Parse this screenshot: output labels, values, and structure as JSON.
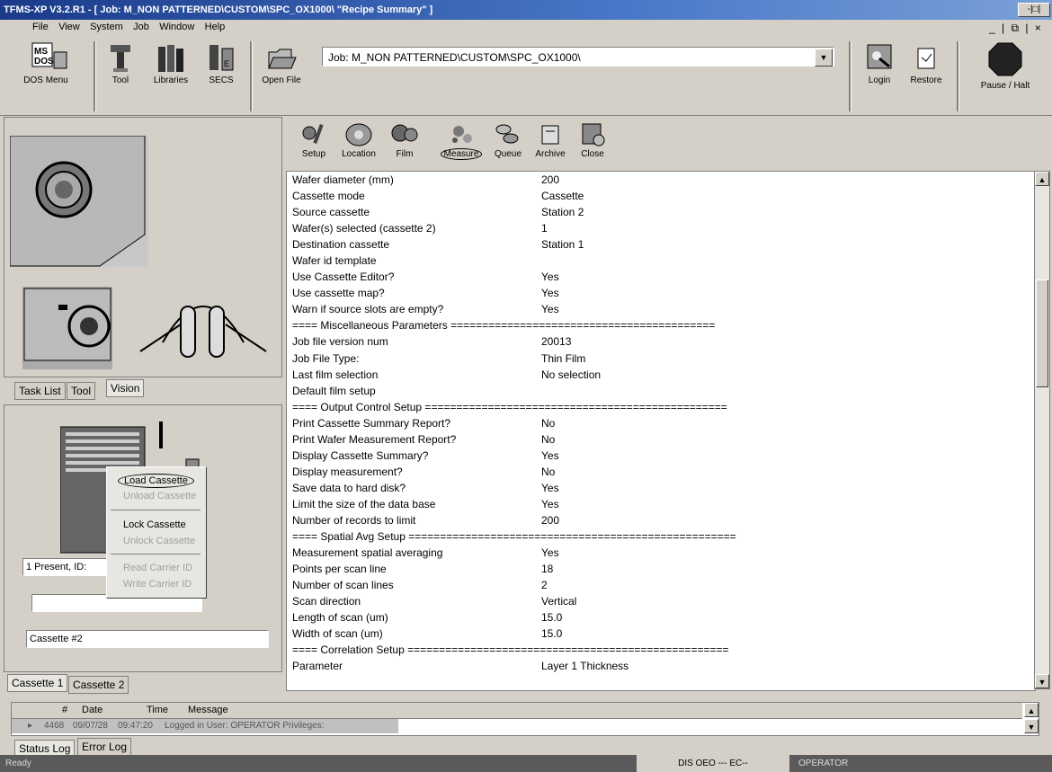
{
  "window": {
    "title": "TFMS-XP V3.2.R1 - [ Job: M_NON PATTERNED\\CUSTOM\\SPC_OX1000\\   \"Recipe Summary\" ]",
    "restore_glyph": "-|□|",
    "doc_controls": "_ | ⧉ | ×"
  },
  "menu": [
    "File",
    "View",
    "System",
    "Job",
    "Window",
    "Help"
  ],
  "toolbar": {
    "dos_menu": "DOS Menu",
    "tool": "Tool",
    "libraries": "Libraries",
    "secs": "SECS",
    "open_file": "Open File",
    "job_field": "Job: M_NON PATTERNED\\CUSTOM\\SPC_OX1000\\",
    "login": "Login",
    "restore": "Restore",
    "pause_halt": "Pause / Halt"
  },
  "recipe_tools": [
    "Setup",
    "Location",
    "Film",
    "Measure",
    "Queue",
    "Archive",
    "Close"
  ],
  "summary_rows": [
    {
      "k": "Wafer diameter (mm)",
      "v": "200"
    },
    {
      "k": "Cassette mode",
      "v": "Cassette"
    },
    {
      "k": "Source cassette",
      "v": "Station 2"
    },
    {
      "k": "Wafer(s) selected (cassette 2)",
      "v": "1"
    },
    {
      "k": "Destination cassette",
      "v": "Station 1"
    },
    {
      "k": "Wafer id template",
      "v": ""
    },
    {
      "k": "Use Cassette Editor?",
      "v": "Yes"
    },
    {
      "k": "Use cassette map?",
      "v": "Yes"
    },
    {
      "k": "Warn if source slots are empty?",
      "v": "Yes"
    },
    {
      "k": "==== Miscellaneous Parameters ==========================================",
      "v": ""
    },
    {
      "k": "Job file version num",
      "v": "20013"
    },
    {
      "k": "Job File Type:",
      "v": "Thin Film"
    },
    {
      "k": "Last film selection",
      "v": "No selection"
    },
    {
      "k": "Default film setup",
      "v": ""
    },
    {
      "k": "==== Output Control Setup ================================================",
      "v": ""
    },
    {
      "k": "Print Cassette Summary Report?",
      "v": "No"
    },
    {
      "k": "Print Wafer Measurement Report?",
      "v": "No"
    },
    {
      "k": "Display Cassette Summary?",
      "v": "Yes"
    },
    {
      "k": "Display measurement?",
      "v": "No"
    },
    {
      "k": "Save data to hard disk?",
      "v": "Yes"
    },
    {
      "k": "Limit the size of the data base",
      "v": "Yes"
    },
    {
      "k": "Number of records to limit",
      "v": "200"
    },
    {
      "k": "==== Spatial Avg Setup ====================================================",
      "v": ""
    },
    {
      "k": "Measurement spatial averaging",
      "v": "Yes"
    },
    {
      "k": "Points per scan line",
      "v": "18"
    },
    {
      "k": "Number of scan lines",
      "v": "2"
    },
    {
      "k": "Scan direction",
      "v": "Vertical"
    },
    {
      "k": "Length of scan (um)",
      "v": "15.0"
    },
    {
      "k": "Width of scan (um)",
      "v": "15.0"
    },
    {
      "k": "==== Correlation Setup ===================================================",
      "v": ""
    },
    {
      "k": "Parameter",
      "v": "Layer 1 Thickness"
    }
  ],
  "left_tabs": [
    "Task List",
    "Tool",
    "Vision"
  ],
  "cassette_panel": {
    "present_field": "1 Present, ID:",
    "cassette_label": "Cassette #2",
    "tabs": [
      "Cassette 1",
      "Cassette 2"
    ]
  },
  "context_menu": {
    "load": "Load Cassette",
    "unload": "Unload Cassette",
    "lock": "Lock Cassette",
    "unlock": "Unlock Cassette",
    "read_id": "Read Carrier ID",
    "write_id": "Write Carrier ID"
  },
  "log": {
    "headers": [
      "#",
      "Date",
      "Time",
      "Message"
    ],
    "row": {
      "num": "4468",
      "date": "09/07/28",
      "time": "09:47:20",
      "message": "Logged in  User: OPERATOR  Privileges:"
    },
    "tabs": [
      "Status Log",
      "Error Log"
    ]
  },
  "status": {
    "left": "Ready",
    "mid": "DIS OEO --- EC--",
    "right": "OPERATOR"
  }
}
